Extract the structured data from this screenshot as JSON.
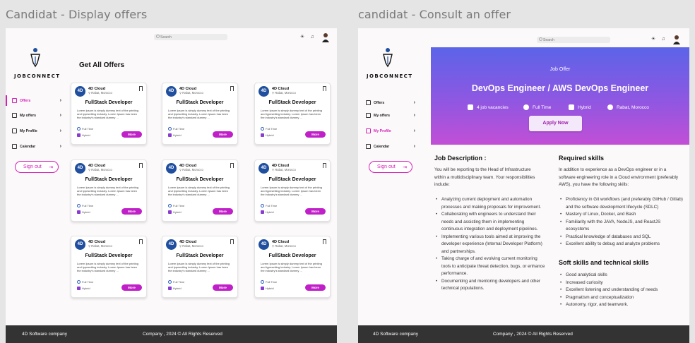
{
  "frames": {
    "left_title": "Candidat - Display offers",
    "right_title": "candidat - Consult an offer"
  },
  "search_placeholder": "Search",
  "brand": {
    "name": "JOBCONNECT",
    "accent_color": "#d61fb8"
  },
  "nav": {
    "items": [
      {
        "label": "Offers",
        "icon": "offers-icon"
      },
      {
        "label": "My offers",
        "icon": "users-icon"
      },
      {
        "label": "My Profile",
        "icon": "profile-icon"
      },
      {
        "label": "Calendar",
        "icon": "calendar-icon"
      }
    ],
    "signout": "Sign out"
  },
  "offers_page": {
    "heading": "Get All Offers",
    "cards": [
      {
        "company": "4D Cloud",
        "location": "Rabat, Morocco",
        "title": "FullStack Developer",
        "desc": "Lorem Ipsum is simply dummy text of the printing and typesetting industry. Lorem Ipsum has been the industry's standard dummy ...",
        "contract": "Full Time",
        "mode": "Hybrid",
        "more": "More"
      },
      {
        "company": "4D Cloud",
        "location": "Rabat, Morocco",
        "title": "FullStack Developer",
        "desc": "Lorem Ipsum is simply dummy text of the printing and typesetting industry. Lorem Ipsum has been the industry's standard dummy ...",
        "contract": "Full Time",
        "mode": "Hybrid",
        "more": "More"
      },
      {
        "company": "4D Cloud",
        "location": "Rabat, Morocco",
        "title": "FullStack Developer",
        "desc": "Lorem Ipsum is simply dummy text of the printing and typesetting industry. Lorem Ipsum has been the industry's standard dummy ...",
        "contract": "Full Time",
        "mode": "Hybrid",
        "more": "More"
      },
      {
        "company": "4D Cloud",
        "location": "Rabat, Morocco",
        "title": "FullStack Developer",
        "desc": "Lorem Ipsum is simply dummy text of the printing and typesetting industry. Lorem Ipsum has been the industry's standard dummy ...",
        "contract": "Full Time",
        "mode": "Hybrid",
        "more": "More"
      },
      {
        "company": "4D Cloud",
        "location": "Rabat, Morocco",
        "title": "FullStack Developer",
        "desc": "Lorem Ipsum is simply dummy text of the printing and typesetting industry. Lorem Ipsum has been the industry's standard dummy ...",
        "contract": "Full Time",
        "mode": "Hybrid",
        "more": "More"
      },
      {
        "company": "4D Cloud",
        "location": "Rabat, Morocco",
        "title": "FullStack Developer",
        "desc": "Lorem Ipsum is simply dummy text of the printing and typesetting industry. Lorem Ipsum has been the industry's standard dummy ...",
        "contract": "Full Time",
        "mode": "Hybrid",
        "more": "More"
      },
      {
        "company": "4D Cloud",
        "location": "Rabat, Morocco",
        "title": "FullStack Developer",
        "desc": "Lorem Ipsum is simply dummy text of the printing and typesetting industry. Lorem Ipsum has been the industry's standard dummy ...",
        "contract": "Full Time",
        "mode": "Hybrid",
        "more": "More"
      },
      {
        "company": "4D Cloud",
        "location": "Rabat, Morocco",
        "title": "FullStack Developer",
        "desc": "Lorem Ipsum is simply dummy text of the printing and typesetting industry. Lorem Ipsum has been the industry's standard dummy ...",
        "contract": "Full Time",
        "mode": "Hybrid",
        "more": "More"
      },
      {
        "company": "4D Cloud",
        "location": "Rabat, Morocco",
        "title": "FullStack Developer",
        "desc": "Lorem Ipsum is simply dummy text of the printing and typesetting industry. Lorem Ipsum has been the industry's standard dummy ...",
        "contract": "Full Time",
        "mode": "Hybrid",
        "more": "More"
      }
    ]
  },
  "offer_detail": {
    "label": "Job Offer",
    "title": "DevOps Engineer / AWS DevOps Engineer",
    "vacancies": "4 job vacancies",
    "contract": "Full Time",
    "mode": "Hybrid",
    "location": "Rabat, Morocco",
    "apply": "Apply Now",
    "description_heading": "Job Description :",
    "description_intro": "You will be reporting to the Head of Infrastructure within a multidisciplinary team. Your responsibilities include:",
    "responsibilities": [
      "Analyzing current deployment and automation processes and making proposals for improvement.",
      "Collaborating with engineers to understand their needs and assisting them in implementing continuous integration and deployment pipelines.",
      "Implementing various tools aimed at improving the developer experience (Internal Developer Platform) and partnerships.",
      "Taking charge of and evolving current monitoring tools to anticipate threat detection, bugs, or enhance performance.",
      "Documenting and mentoring developers and other technical populations."
    ],
    "required_heading": "Required skills",
    "required_intro": "In addition to experience as a DevOps engineer or in a software engineering role in a Cloud environment (preferably AWS), you have the following skills:",
    "required_skills": [
      "Proficiency in Git workflows (and preferably GitHub / Gitlab) and the software development lifecycle (SDLC)",
      "Mastery of Linux, Docker, and Bash",
      "Familiarity with the JAVA, NodeJS, and ReactJS ecosystems",
      "Practical knowledge of databases and SQL",
      "Excellent ability to debug and analyze problems"
    ],
    "soft_heading": "Soft skills and technical skills",
    "soft_skills": [
      "Good analytical skills",
      "Increased curiosity",
      "Excellent listening and understanding of needs",
      "Pragmatism and conceptualization",
      "Autonomy, rigor, and teamwork."
    ]
  },
  "footer": {
    "company": "4D Software company",
    "rights": "Company , 2024 © All Rights Reserved"
  }
}
